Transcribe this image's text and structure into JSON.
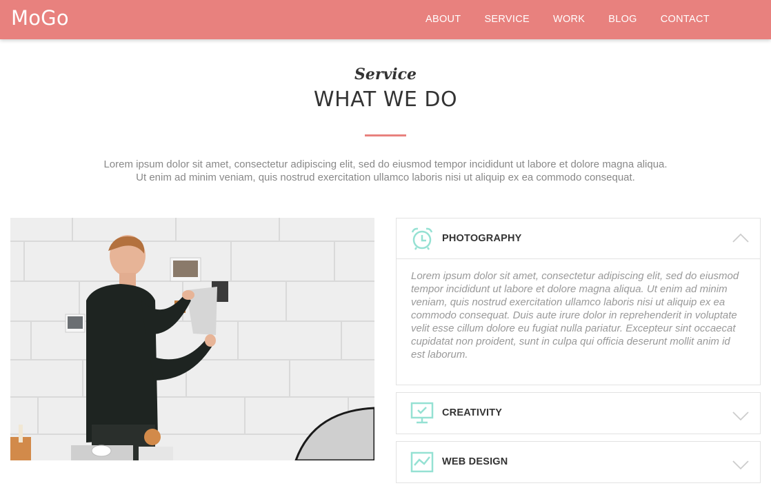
{
  "header": {
    "logo": "MoGo",
    "nav": [
      "ABOUT",
      "SERVICE",
      "WORK",
      "BLOG",
      "CONTACT"
    ]
  },
  "section": {
    "subtitle": "Service",
    "title": "WHAT WE DO",
    "intro_line1": "Lorem ipsum dolor sit amet, consectetur adipiscing elit, sed do eiusmod tempor incididunt ut labore et dolore magna aliqua.",
    "intro_line2": "Ut enim ad minim veniam, quis nostrud exercitation ullamco laboris nisi ut aliquip ex ea commodo consequat."
  },
  "accordion": [
    {
      "title": "PHOTOGRAPHY",
      "icon": "alarm-clock-icon",
      "expanded": true,
      "body": "Lorem ipsum dolor sit amet, consectetur adipiscing elit, sed do eiusmod tempor incididunt ut labore et dolore magna aliqua. Ut enim ad minim veniam, quis nostrud exercitation ullamco laboris nisi ut aliquip ex ea commodo consequat. Duis aute irure dolor in reprehenderit in voluptate velit esse cillum dolore eu fugiat nulla pariatur. Excepteur sint occaecat cupidatat non proident, sunt in culpa qui officia deserunt mollit anim id est laborum."
    },
    {
      "title": "CREATIVITY",
      "icon": "monitor-check-icon",
      "expanded": false
    },
    {
      "title": "WEB DESIGN",
      "icon": "chart-line-icon",
      "expanded": false
    }
  ],
  "colors": {
    "brand": "#e8817e",
    "icon": "#95e1d3"
  }
}
